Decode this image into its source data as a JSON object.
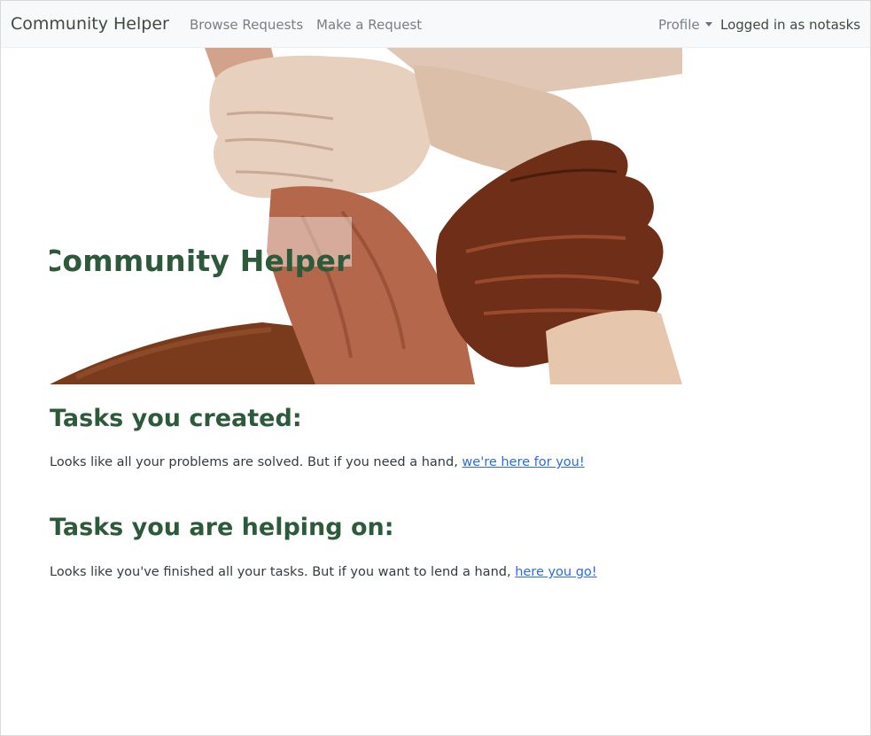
{
  "navbar": {
    "brand": "Community Helper",
    "links": {
      "browse": "Browse Requests",
      "make": "Make a Request"
    },
    "profile_label": "Profile",
    "logged_in_text": "Logged in as notasks"
  },
  "hero": {
    "title": "Community Helper",
    "image_icon": "stacked-hands-image"
  },
  "tasks_created": {
    "heading": "Tasks you created:",
    "text": "Looks like all your problems are solved. But if you need a hand, ",
    "link": "we're here for you!"
  },
  "tasks_helping": {
    "heading": "Tasks you are helping on:",
    "text": "Looks like you've finished all your tasks. But if you want to lend a hand, ",
    "link": "here you go!"
  },
  "colors": {
    "heading_green": "#2d5a3a",
    "link_blue": "#2b6cd8",
    "navbar_bg": "#f8f9fa"
  }
}
